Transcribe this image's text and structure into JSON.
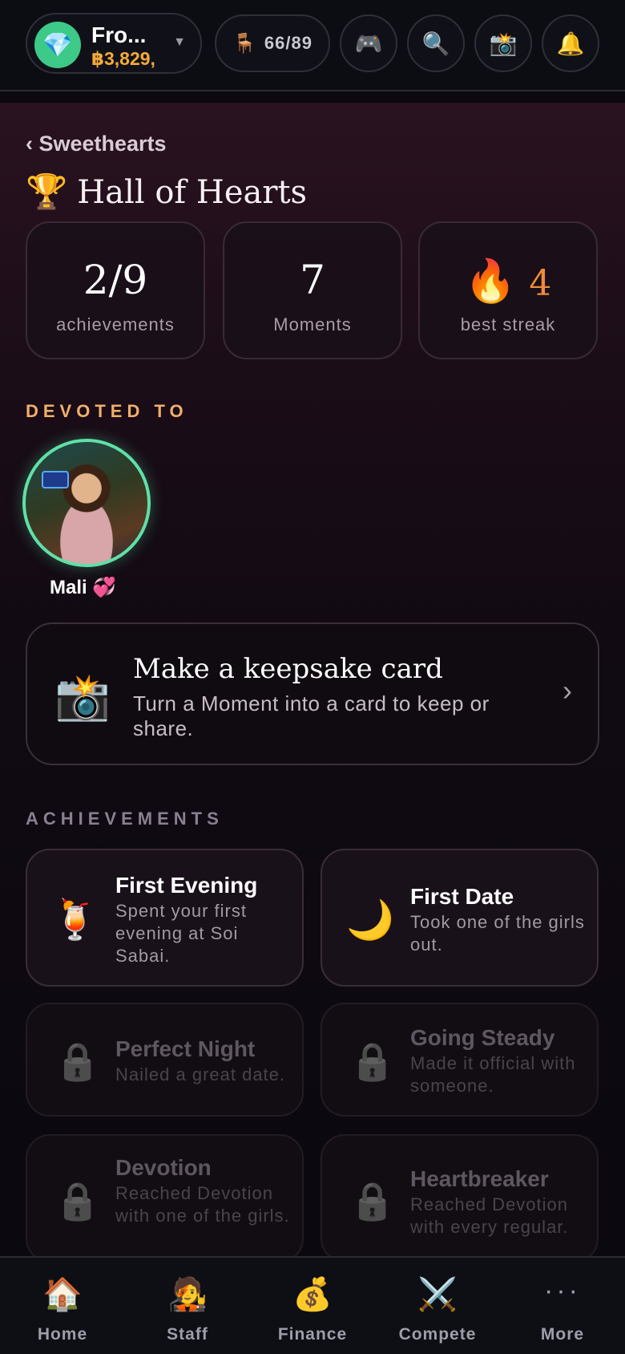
{
  "topbar": {
    "wallet_name": "Fro...",
    "wallet_money": "฿3,829,",
    "seats": "66/89",
    "icons": [
      "gem-icon",
      "chair-icon",
      "gamepad-icon",
      "search-icon",
      "camera-flash-icon",
      "bell-icon"
    ]
  },
  "page": {
    "back_label": "‹ Sweethearts",
    "title": "Hall of Hearts"
  },
  "stats": [
    {
      "value": "2/9",
      "caption": "achievements"
    },
    {
      "value": "7",
      "caption": "Moments"
    },
    {
      "value": "4",
      "caption": "best streak"
    }
  ],
  "devoted": {
    "label": "DEVOTED TO",
    "name": "Mali 💞"
  },
  "keepsake": {
    "title": "Make a keepsake card",
    "subtitle": "Turn a Moment into a card to keep or share.",
    "chevron": "›"
  },
  "achievements_label": "ACHIEVEMENTS",
  "achievements": [
    {
      "title": "First Evening",
      "desc": "Spent your first evening at Soi Sabai.",
      "icon": "🍹",
      "locked": false
    },
    {
      "title": "First Date",
      "desc": "Took one of the girls out.",
      "icon": "🌙",
      "locked": false
    },
    {
      "title": "Perfect Night",
      "desc": "Nailed a great date.",
      "icon": "🔒",
      "locked": true
    },
    {
      "title": "Going Steady",
      "desc": "Made it official with someone.",
      "icon": "🔒",
      "locked": true
    },
    {
      "title": "Devotion",
      "desc": "Reached Devotion with one of the girls.",
      "icon": "🔒",
      "locked": true
    },
    {
      "title": "Heartbreaker",
      "desc": "Reached Devotion with every regular.",
      "icon": "🔒",
      "locked": true
    }
  ],
  "tabs": [
    {
      "label": "Home",
      "icon": "🏠"
    },
    {
      "label": "Staff",
      "icon": "🧑‍🎤"
    },
    {
      "label": "Finance",
      "icon": "💰"
    },
    {
      "label": "Compete",
      "icon": "⚔️"
    },
    {
      "label": "More",
      "icon": "···"
    }
  ],
  "colors": {
    "accent_gold": "#f4a93a",
    "section_gold": "#f0b069",
    "avatar_ring": "#5fe0a6",
    "streak": "#ef8b3a"
  }
}
